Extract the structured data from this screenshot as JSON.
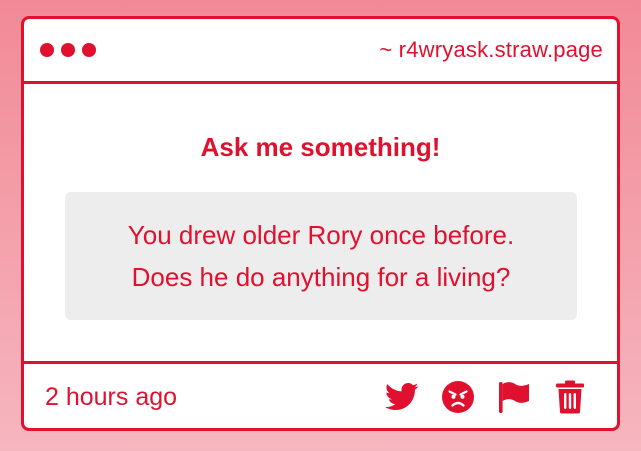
{
  "window": {
    "url_label": "~ r4wryask.straw.page"
  },
  "main": {
    "heading": "Ask me something!",
    "question_line1": "You drew older Rory once before.",
    "question_line2": "Does he do anything for a living?"
  },
  "footer": {
    "timestamp": "2 hours ago",
    "actions": [
      {
        "icon": "twitter-icon"
      },
      {
        "icon": "angry-face-icon"
      },
      {
        "icon": "flag-icon"
      },
      {
        "icon": "trash-icon"
      }
    ]
  },
  "colors": {
    "accent": "#e0112e",
    "question_bg": "#eeedee",
    "background_top": "#f18a96",
    "background_bottom": "#f6b6bf"
  }
}
